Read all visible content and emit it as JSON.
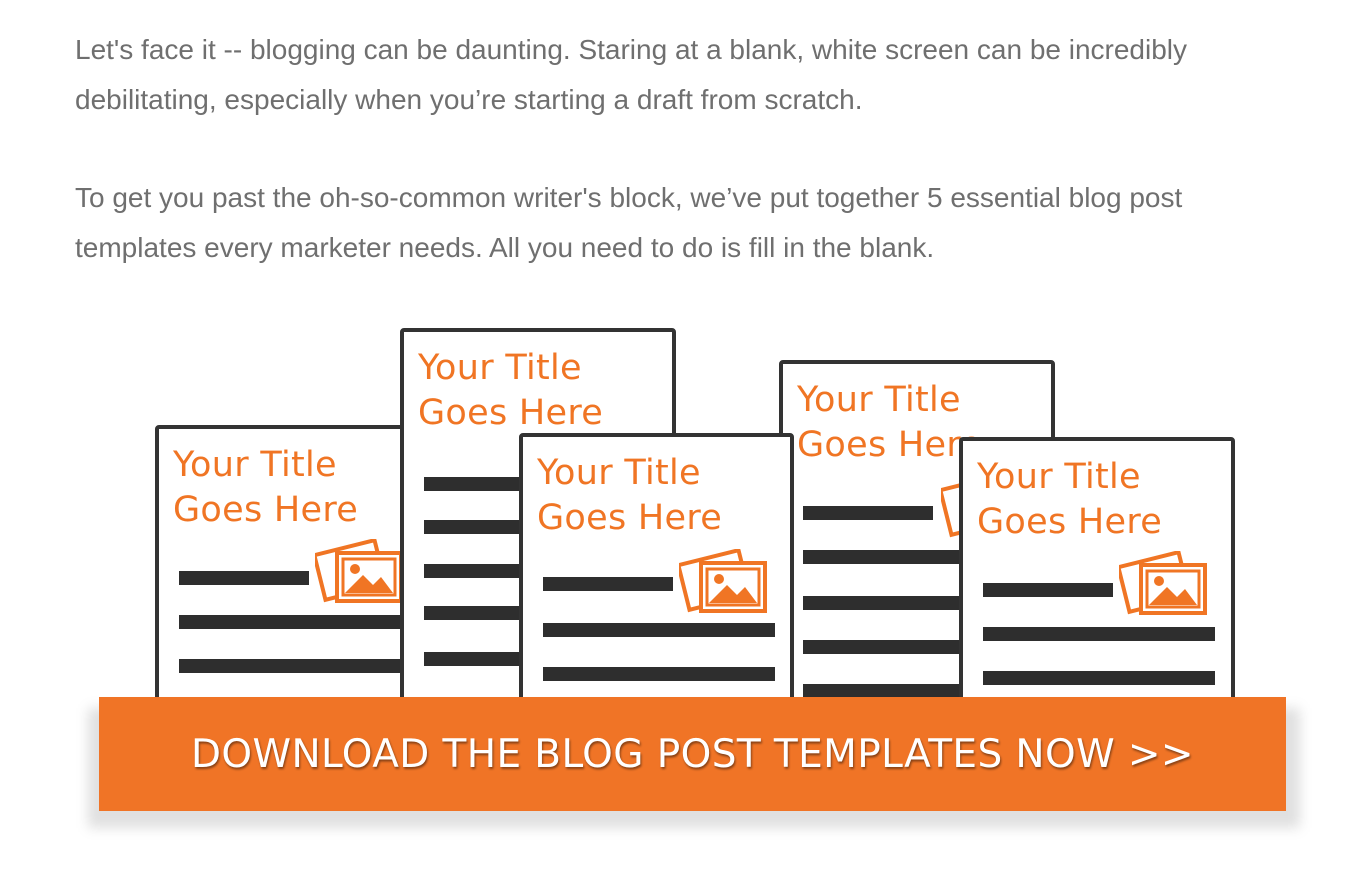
{
  "article": {
    "paragraph1": "Let's face it -- blogging can be daunting. Staring at a blank, white screen can be incredibly debilitating, especially when you’re starting a draft from scratch.",
    "paragraph2": "To get you past the oh-so-common writer's block, we’ve put together 5 essential blog post templates every marketer needs. All you need to do is fill in the blank."
  },
  "promo": {
    "template_title": "Your Title Goes Here",
    "cta_label": "DOWNLOAD THE BLOG POST TEMPLATES NOW >>",
    "accent_color": "#f07426",
    "icon": "image-icon"
  }
}
